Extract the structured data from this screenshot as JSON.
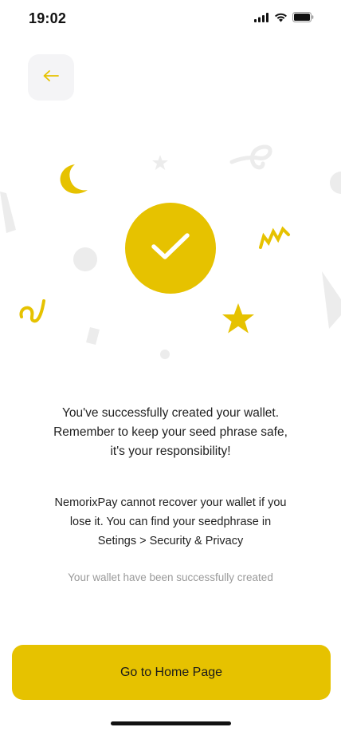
{
  "status_bar": {
    "time": "19:02",
    "icons": [
      "signal-icon",
      "wifi-icon",
      "battery-icon"
    ]
  },
  "header": {
    "back_icon": "arrow-left-icon"
  },
  "illustration": {
    "center_icon": "checkmark-icon",
    "accent_color": "#e6c200",
    "decor_color": "#ececec"
  },
  "messages": {
    "primary_line1": "You've successfully created your wallet.",
    "primary_line2": "Remember to keep your seed phrase safe,",
    "primary_line3": "it's your responsibility!",
    "secondary_line1": "NemorixPay cannot recover your wallet if you",
    "secondary_line2": "lose it. You can find your seedphrase in",
    "secondary_line3": "Setings > Security & Privacy",
    "status": "Your wallet have been successfully created"
  },
  "actions": {
    "home_button_label": "Go to Home Page"
  }
}
